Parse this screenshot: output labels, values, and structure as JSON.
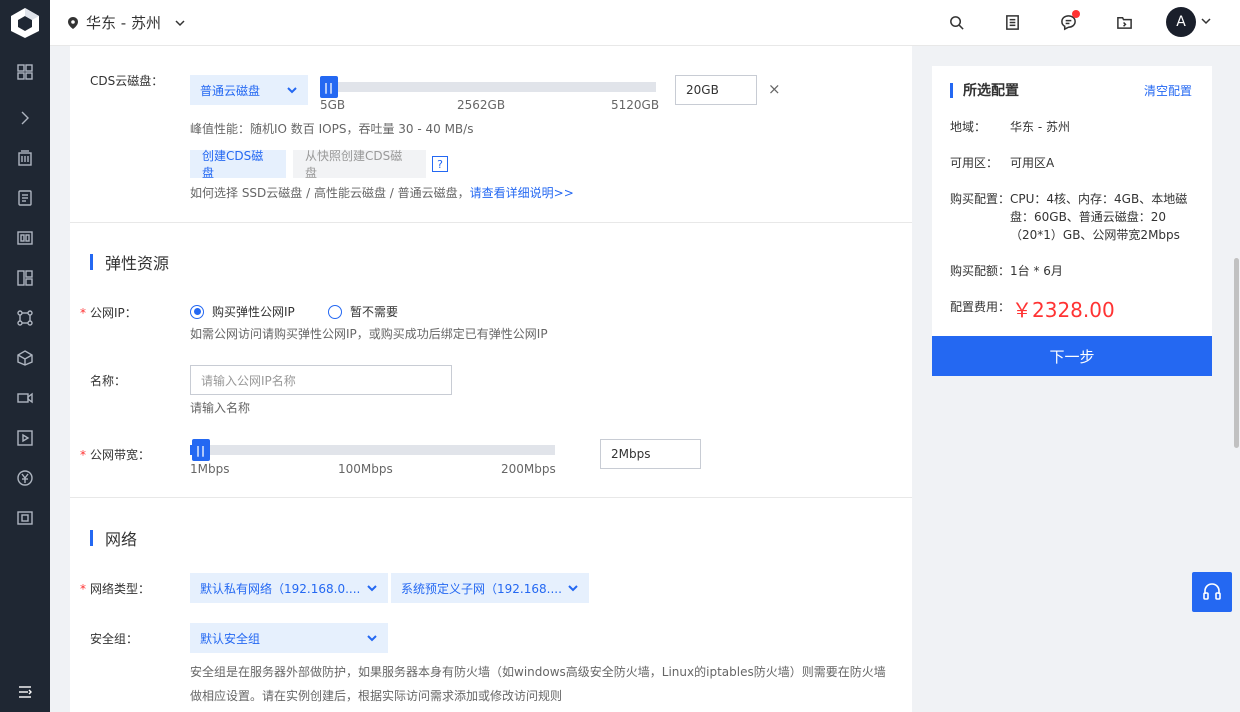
{
  "header": {
    "region_label": "华东 - 苏州",
    "avatar_letter": "A"
  },
  "storage": {
    "cds_label": "CDS云磁盘：",
    "disk_type": "普通云磁盘",
    "slider_ticks": [
      "5GB",
      "2562GB",
      "5120GB"
    ],
    "slider_value_fraction": 0.0,
    "size_value": "20GB",
    "remove_symbol": "×",
    "perf_hint": "峰值性能：随机IO 数百 IOPS，吞吐量 30 - 40 MB/s",
    "create_btn": "创建CDS磁盘",
    "snapshot_btn": "从快照创建CDS磁盘",
    "help_symbol": "?",
    "choose_hint": "如何选择 SSD云磁盘 / 高性能云磁盘 / 普通云磁盘，",
    "choose_link": "请查看详细说明>>"
  },
  "elastic": {
    "title": "弹性资源",
    "public_ip_label": "公网IP：",
    "option_buy": "购买弹性公网IP",
    "option_none": "暂不需要",
    "ip_hint": "如需公网访问请购买弹性公网IP，或购买成功后绑定已有弹性公网IP",
    "name_label": "名称：",
    "name_placeholder": "请输入公网IP名称",
    "name_hint": "请输入名称",
    "bandwidth_label": "公网带宽：",
    "bw_ticks": [
      "1Mbps",
      "100Mbps",
      "200Mbps"
    ],
    "bw_value": "2Mbps"
  },
  "network": {
    "title": "网络",
    "type_label": "网络类型：",
    "vpc_select": "默认私有网络（192.168.0....",
    "subnet_select": "系统预定义子网（192.168....",
    "sg_label": "安全组：",
    "sg_select": "默认安全组",
    "sg_hint_1": "安全组是在服务器外部做防护，如果服务器本身有防火墙（如windows高级安全防火墙，Linux的iptables防火墙）则需要在防火墙",
    "sg_hint_2": "做相应设置。请在实例创建后，根据实际访问需求添加或修改访问规则"
  },
  "summary": {
    "title": "所选配置",
    "clear": "清空配置",
    "region_key": "地域：",
    "region_val": "华东 - 苏州",
    "zone_key": "可用区：",
    "zone_val": "可用区A",
    "config_key": "购买配置：",
    "config_val": "CPU：4核、内存：4GB、本地磁盘：60GB、普通云磁盘：20（20*1）GB、公网带宽2Mbps",
    "amount_key": "购买配额：",
    "amount_val": "1台 * 6月",
    "fee_key": "配置费用：",
    "fee_val": "￥2328.00",
    "next": "下一步"
  },
  "colors": {
    "accent": "#2468f2",
    "price": "#ff3333",
    "sidebar": "#1f2733"
  }
}
